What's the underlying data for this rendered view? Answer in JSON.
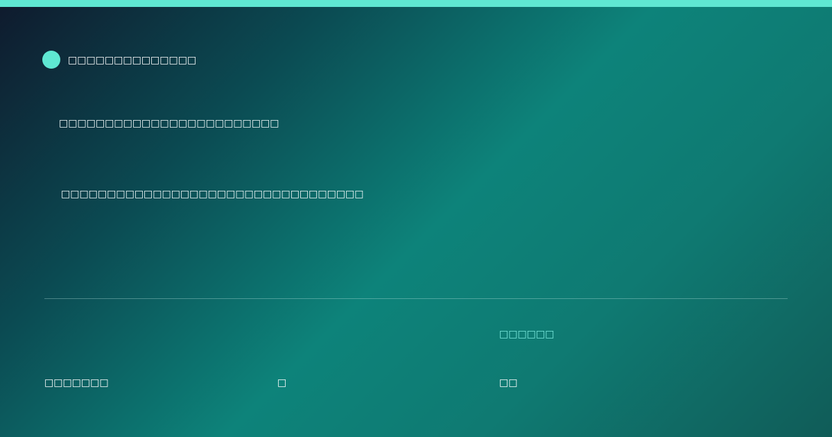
{
  "brand": {
    "name": "□□□□□□□□□□□□□□",
    "accent_color": "#5fe7d2"
  },
  "hero": {
    "headline": "□□□□□□□□□□□□□□□□□□□□□□□□",
    "subtext": "□□□□□□□□□□□□□□□□□□□□□□□□□□□□□□□□□"
  },
  "stats": {
    "label": "□□□□□□"
  },
  "footer": {
    "left": "□□□□□□□",
    "center": "□",
    "right": "□□"
  },
  "colors": {
    "background_start": "#0f1a2d",
    "background_mid": "#0d837a",
    "background_end": "#105c58",
    "text": "#ffffff",
    "muted_accent": "#7dece0"
  }
}
